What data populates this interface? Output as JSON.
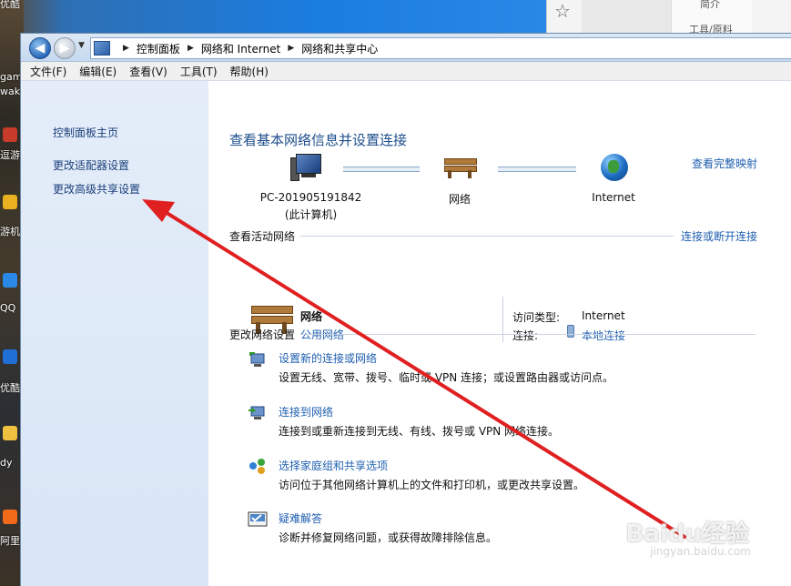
{
  "desktop": {
    "left_labels": [
      "优酷",
      "gam",
      "wak",
      "逗游",
      "游机",
      "QQ",
      "优酷",
      "dy",
      "阿里"
    ],
    "browser_strip": {
      "top_label": "简介",
      "bottom_label": "工具/原料"
    }
  },
  "addressbar": {
    "crumbs": [
      "控制面板",
      "网络和 Internet",
      "网络和共享中心"
    ]
  },
  "menubar": {
    "items": [
      "文件(F)",
      "编辑(E)",
      "查看(V)",
      "工具(T)",
      "帮助(H)"
    ]
  },
  "sidebar": {
    "links": [
      "控制面板主页",
      "更改适配器设置",
      "更改高级共享设置"
    ]
  },
  "main": {
    "heading": "查看基本网络信息并设置连接",
    "map_link": "查看完整映射",
    "nodes": {
      "pc_name": "PC-201905191842",
      "pc_sub": "(此计算机)",
      "network": "网络",
      "internet": "Internet"
    },
    "active": {
      "title": "查看活动网络",
      "connect_link": "连接或断开连接",
      "network_name": "网络",
      "network_type": "公用网络",
      "access_type_label": "访问类型:",
      "access_type_value": "Internet",
      "connection_label": "连接:",
      "connection_value": "本地连接"
    },
    "settings_title": "更改网络设置",
    "tasks": [
      {
        "title": "设置新的连接或网络",
        "desc": "设置无线、宽带、拨号、临时或 VPN 连接；或设置路由器或访问点。"
      },
      {
        "title": "连接到网络",
        "desc": "连接到或重新连接到无线、有线、拨号或 VPN 网络连接。"
      },
      {
        "title": "选择家庭组和共享选项",
        "desc": "访问位于其他网络计算机上的文件和打印机，或更改共享设置。"
      },
      {
        "title": "疑难解答",
        "desc": "诊断并修复网络问题，或获得故障排除信息。"
      }
    ]
  },
  "watermark": {
    "brand": "Baidu经验",
    "sub": "jingyan.baidu.com"
  },
  "colors": {
    "link": "#1f5fb0",
    "heading": "#1e4e8c",
    "annotation": "#e02020"
  },
  "icons": [
    "back-arrow-icon",
    "forward-arrow-icon",
    "control-panel-icon",
    "computer-icon",
    "bench-network-icon",
    "globe-icon",
    "plug-icon",
    "new-connection-icon",
    "connect-network-icon",
    "homegroup-icon",
    "troubleshoot-icon"
  ]
}
